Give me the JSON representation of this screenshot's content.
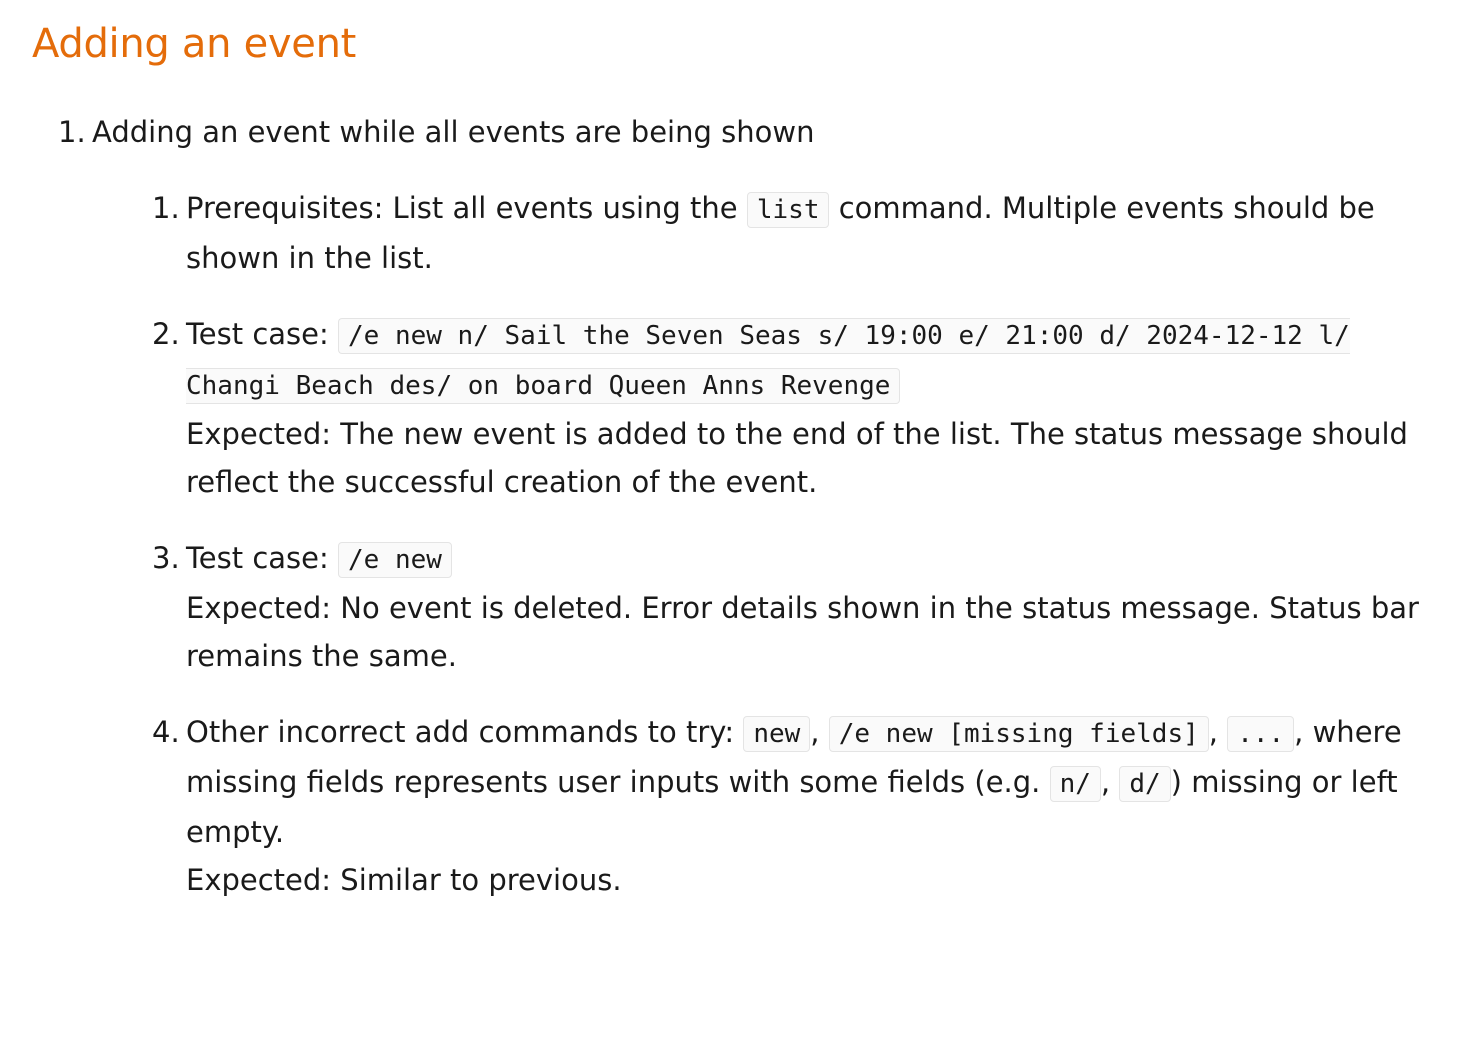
{
  "title": "Adding an event",
  "outer_item": {
    "number": "1.",
    "text": "Adding an event while all events are being shown"
  },
  "items": [
    {
      "number": "1.",
      "pre": "Prerequisites: List all events using the ",
      "code": "list",
      "post": " command. Multiple events should be shown in the list."
    },
    {
      "number": "2.",
      "pre": "Test case: ",
      "code": "/e new n/ Sail the Seven Seas s/ 19:00 e/ 21:00 d/ 2024-12-12 l/ Changi Beach des/ on board Queen Anns Revenge",
      "expected": "Expected: The new event is added to the end of the list. The status message should reflect the successful creation of the event."
    },
    {
      "number": "3.",
      "pre": "Test case: ",
      "code": "/e new",
      "expected": "Expected: No event is deleted. Error details shown in the status message. Status bar remains the same."
    },
    {
      "number": "4.",
      "pre": "Other incorrect add commands to try: ",
      "code1": "new",
      "sep1": ", ",
      "code2": "/e new [missing fields]",
      "sep2": ", ",
      "code3": "...",
      "mid": ", where missing fields represents user inputs with some fields (e.g. ",
      "code4": "n/",
      "sep3": ", ",
      "code5": "d/",
      "post": ") missing or left empty.",
      "expected": "Expected: Similar to previous."
    }
  ]
}
